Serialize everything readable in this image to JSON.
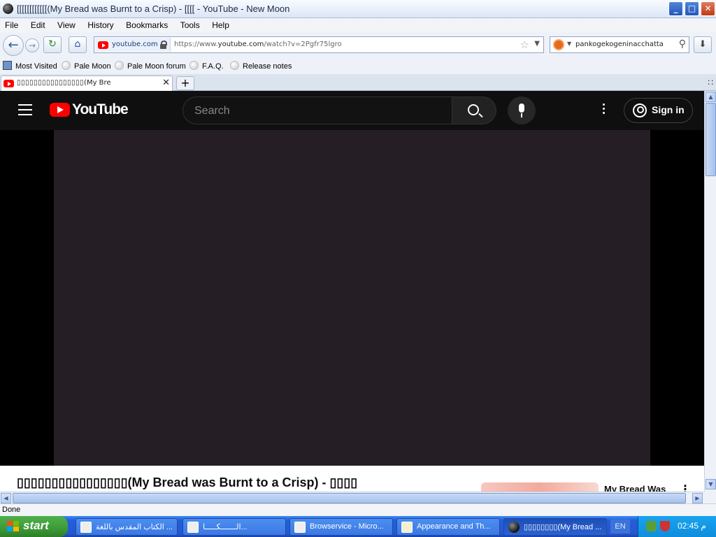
{
  "window": {
    "title": "[[[[[[[[[[[[(My Bread was Burnt to a Crisp) - [[[[ - YouTube - New Moon",
    "minimize": "_",
    "maximize": "□",
    "close": "✕"
  },
  "menu": [
    "File",
    "Edit",
    "View",
    "History",
    "Bookmarks",
    "Tools",
    "Help"
  ],
  "nav": {
    "domain": "youtube.com",
    "url_prefix": "https://www.",
    "url_host": "youtube.com",
    "url_path": "/watch?v=2Pgfr75lgro",
    "search_value": "pankogekogeninacchatta"
  },
  "bookmarks": [
    "Most Visited",
    "Pale Moon",
    "Pale Moon forum",
    "F.A.Q.",
    "Release notes"
  ],
  "tab": {
    "title_boxes": "▯▯▯▯▯▯▯▯▯▯▯▯▯▯▯▯",
    "title_text": "(My Bre"
  },
  "youtube": {
    "wordmark": "YouTube",
    "search_placeholder": "Search",
    "sign_in": "Sign in",
    "video_title_boxes": "▯▯▯▯▯▯▯▯▯▯▯▯▯▯▯▯",
    "video_title_text": "(My Bread was Burnt to a Crisp) - ",
    "video_title_suffix": "▯▯▯▯",
    "sidebar_title": "My Bread Was",
    "player_color": "#261e25"
  },
  "status": {
    "text": "Done"
  },
  "taskbar": {
    "start": "start",
    "items": [
      "الكتاب المقدس باللغة ...",
      "الـــــــكـــــا...",
      "Browservice - Micro...",
      "Appearance and Th...",
      "▯▯▯▯▯▯▯▯(My Bread ..."
    ],
    "lang": "EN",
    "clock": "02:45 م"
  }
}
